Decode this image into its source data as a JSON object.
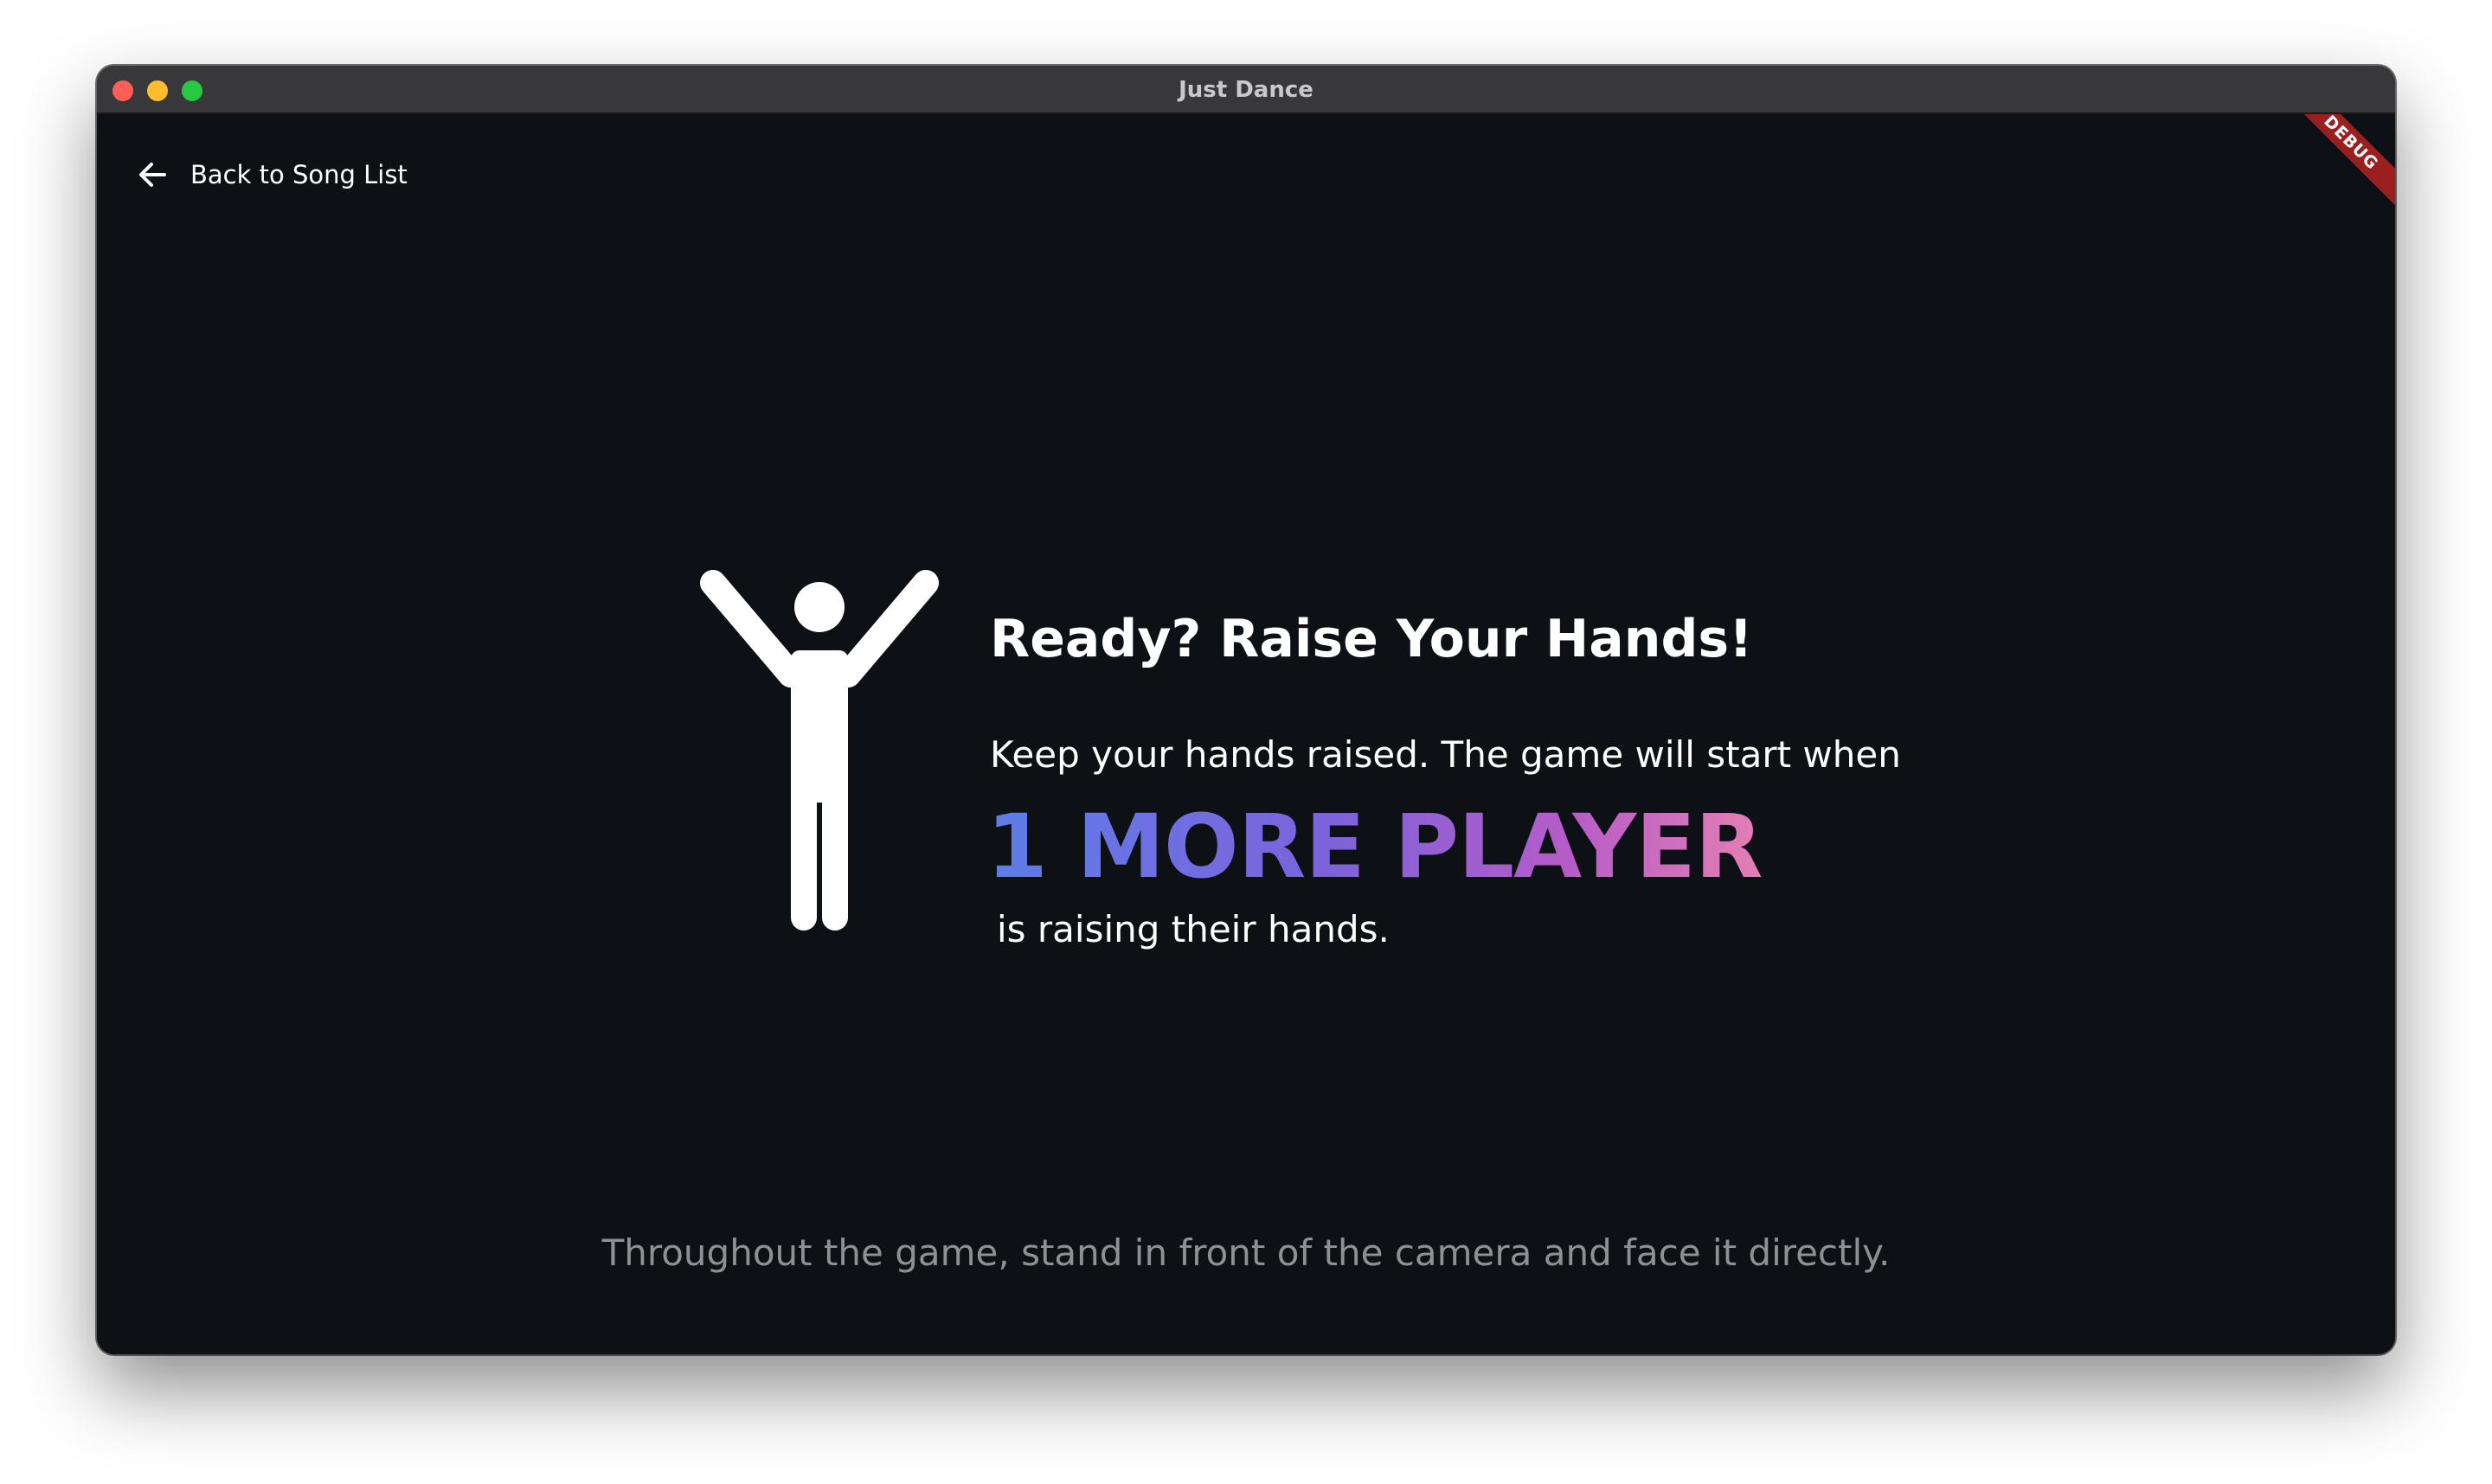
{
  "window": {
    "title": "Just Dance"
  },
  "nav": {
    "back_label": "Back to Song List",
    "back_icon": "arrow-left-icon"
  },
  "debug_banner": "DEBUG",
  "main": {
    "figure_icon": "person-raising-hands-icon",
    "headline": "Ready? Raise Your Hands!",
    "instruction_line1": "Keep your hands raised. The game will start when",
    "players_needed": "1 MORE PLAYER",
    "instruction_line2": "is raising their hands."
  },
  "footer_note": "Throughout the game, stand in front of the camera and face it directly.",
  "colors": {
    "background": "#0d1116",
    "titlebar": "#38383a",
    "gradient_start": "#5d7de8",
    "gradient_end": "#e47fb3",
    "muted_text": "#8e9094",
    "debug_banner": "#9c1f1f"
  }
}
